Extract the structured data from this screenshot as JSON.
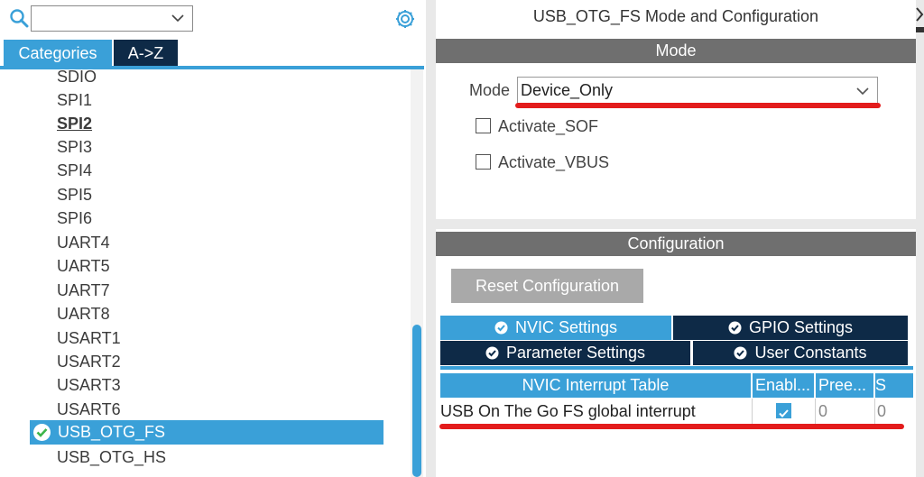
{
  "left_panel": {
    "search": {
      "value": "",
      "icon": "search-icon"
    },
    "settings_icon": "gear-icon",
    "tabs": {
      "categories": "Categories",
      "a_to_z": "A->Z"
    },
    "items": [
      "SDIO",
      "SPI1",
      "SPI2",
      "SPI3",
      "SPI4",
      "SPI5",
      "SPI6",
      "UART4",
      "UART5",
      "UART7",
      "UART8",
      "USART1",
      "USART2",
      "USART3",
      "USART6",
      "USB_OTG_FS",
      "USB_OTG_HS"
    ],
    "selected_item": "USB_OTG_FS",
    "bold_item": "SPI2"
  },
  "right_panel": {
    "title": "USB_OTG_FS Mode and Configuration",
    "mode_header": "Mode",
    "mode_label": "Mode",
    "mode_value": "Device_Only",
    "checkboxes": [
      {
        "label": "Activate_SOF",
        "checked": false
      },
      {
        "label": "Activate_VBUS",
        "checked": false
      }
    ],
    "config_header": "Configuration",
    "reset_button": "Reset Configuration",
    "config_tabs": {
      "nvic": "NVIC Settings",
      "gpio": "GPIO Settings",
      "parameter": "Parameter Settings",
      "user_constants": "User Constants"
    },
    "table": {
      "headers": [
        "NVIC Interrupt Table",
        "Enabl...",
        "Pree...",
        "S"
      ],
      "rows": [
        {
          "name": "USB On The Go FS global interrupt",
          "enabled": true,
          "preemption": "0",
          "sub": "0"
        }
      ]
    }
  },
  "colors": {
    "accent": "#3aa0d8",
    "dark_tab": "#0e2a47",
    "header_gray": "#6f6f6f",
    "annotation_red": "#e31c1c"
  }
}
